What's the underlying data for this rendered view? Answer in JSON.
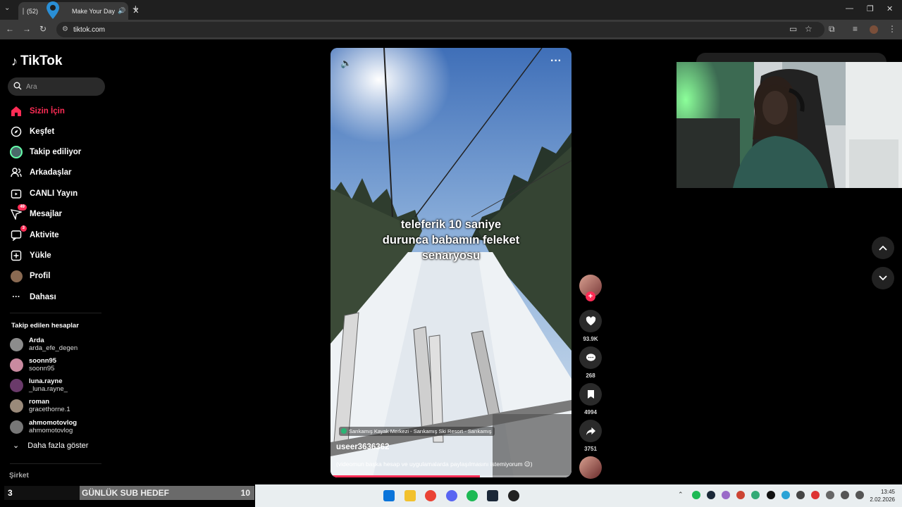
{
  "browser": {
    "tab_title_prefix": "(52)",
    "tab_title": "Make Your Day",
    "new_tab_symbol": "+",
    "url": "tiktok.com"
  },
  "sidebar": {
    "logo_text": "TikTok",
    "search_placeholder": "Ara",
    "nav": [
      {
        "label": "Sizin İçin",
        "icon": "home-icon",
        "active": true
      },
      {
        "label": "Keşfet",
        "icon": "compass-icon"
      },
      {
        "label": "Takip ediliyor",
        "icon": "following-avatar-icon"
      },
      {
        "label": "Arkadaşlar",
        "icon": "friends-icon"
      },
      {
        "label": "CANLI Yayın",
        "icon": "live-icon"
      },
      {
        "label": "Mesajlar",
        "icon": "messages-icon",
        "badge": "49"
      },
      {
        "label": "Aktivite",
        "icon": "activity-icon",
        "badge": "3"
      },
      {
        "label": "Yükle",
        "icon": "upload-icon"
      },
      {
        "label": "Profil",
        "icon": "profile-avatar-icon"
      },
      {
        "label": "Dahası",
        "icon": "more-dots-icon"
      }
    ],
    "following_title": "Takip edilen hesaplar",
    "following": [
      {
        "name": "Arda",
        "handle": "arda_efe_degen"
      },
      {
        "name": "soonn95",
        "handle": "soonn95"
      },
      {
        "name": "luna.rayne",
        "handle": "_luna.rayne_"
      },
      {
        "name": "roman",
        "handle": "gracethorne.1"
      },
      {
        "name": "ahmomotovlog",
        "handle": "ahmomotovlog"
      }
    ],
    "show_more": "Daha fazla göster",
    "company": "Şirket"
  },
  "video": {
    "caption_lines": [
      "teleferik 10 saniye",
      "durunca babamın feleket",
      "senaryosu"
    ],
    "location": "Sarıkamış Kayak Merkezi - Sarıkamış Ski Resort - Sarıkamış",
    "username": "useer3636362",
    "description": "(videomun başka hesap ve uygulamalarda paylaşılmasını istemiyorum 😉)",
    "progress": 0.62
  },
  "actions": {
    "likes": "93.9K",
    "comments": "268",
    "saves": "4994",
    "shares": "3751"
  },
  "overlay": {
    "sub_goal_current": "3",
    "sub_goal_label": "GÜNLÜK SUB HEDEF",
    "sub_goal_target": "10"
  },
  "taskbar": {
    "time": "13:45",
    "date": "2.02.2026"
  },
  "colors": {
    "accent": "#fe2c55",
    "sidebar_bg": "#000000",
    "chrome_bg": "#1f1f1f"
  }
}
